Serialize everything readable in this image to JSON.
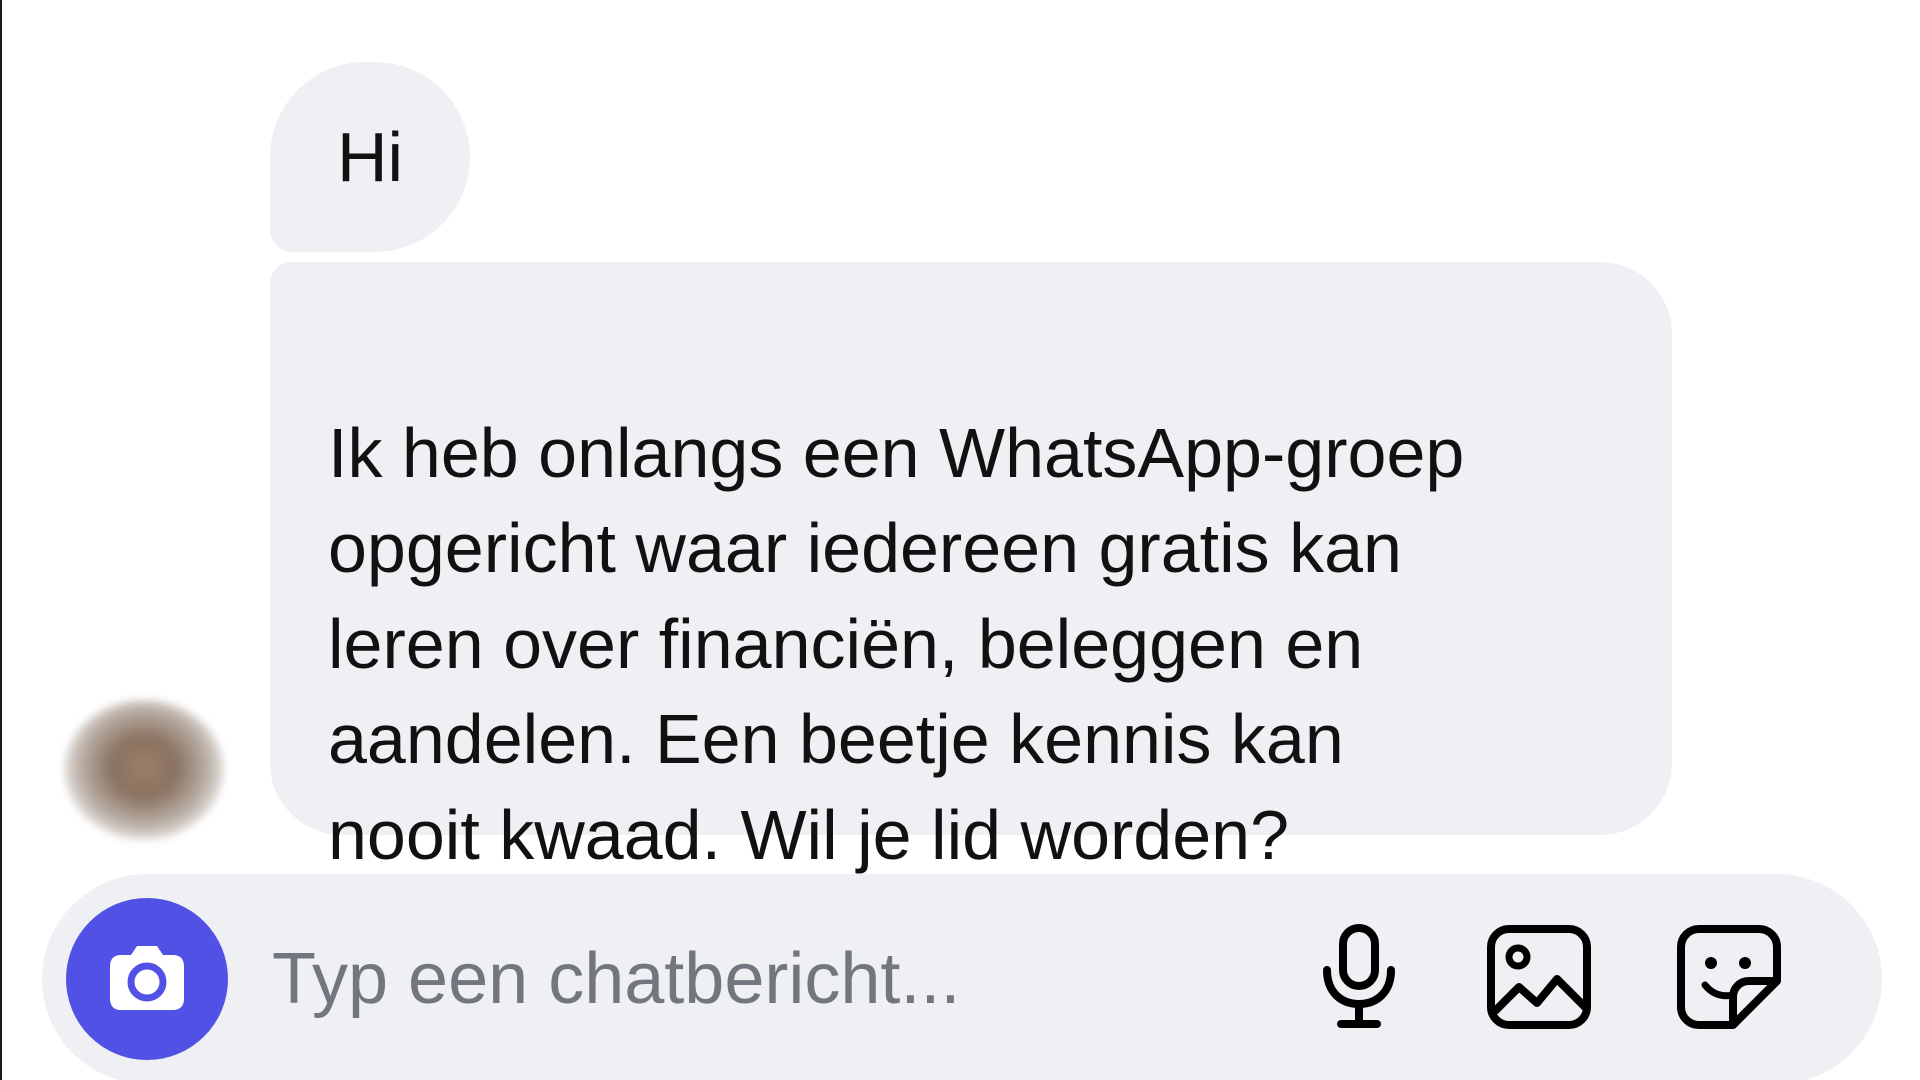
{
  "messages": [
    {
      "text": "Hi"
    },
    {
      "text": "Ik heb onlangs een WhatsApp-groep\nopgericht waar iedereen gratis kan\nleren over financiën, beleggen en\naandelen. Een beetje kennis kan\nnooit kwaad. Wil je lid worden?"
    }
  ],
  "composer": {
    "placeholder": "Typ een chatbericht...",
    "value": ""
  },
  "icons": {
    "camera": "camera-icon",
    "microphone": "microphone-icon",
    "gallery": "image-gallery-icon",
    "sticker": "sticker-icon"
  },
  "colors": {
    "accent": "#5151e6",
    "bubble": "#eff0f3",
    "placeholder": "#73767e",
    "text": "#111111"
  }
}
